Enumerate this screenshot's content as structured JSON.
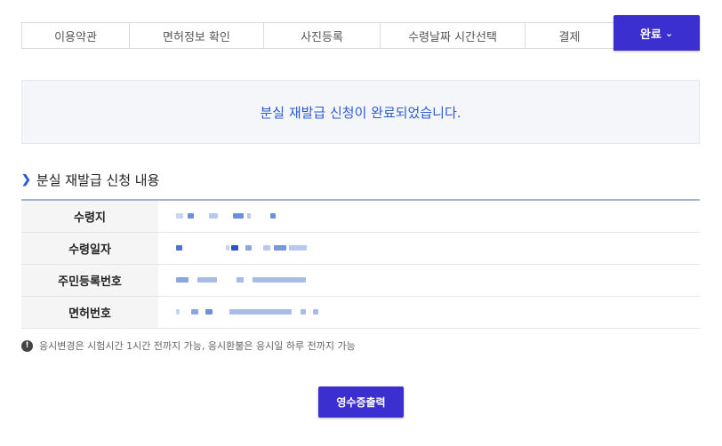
{
  "steps": [
    {
      "label": "이용약관"
    },
    {
      "label": "면허정보 확인"
    },
    {
      "label": "사진등록"
    },
    {
      "label": "수령날짜 시간선택"
    },
    {
      "label": "결제"
    },
    {
      "label": "완료",
      "active": true
    }
  ],
  "banner": {
    "message": "분실 재발급 신청이 완료되었습니다."
  },
  "section": {
    "title": "분실 재발급 신청 내용"
  },
  "table": {
    "rows": [
      {
        "label": "수령지"
      },
      {
        "label": "수령일자"
      },
      {
        "label": "주민등록번호"
      },
      {
        "label": "면허번호"
      }
    ]
  },
  "notice": {
    "text": "응시변경은 시험시간 1시간 전까지 가능, 응시환불은 응시일 하루 전까지 가능"
  },
  "buttons": {
    "receipt": "영수증출력"
  },
  "colors": {
    "accent": "#3b2fd0",
    "banner_text": "#2d5bd6",
    "blur": "#8ea6e0"
  }
}
